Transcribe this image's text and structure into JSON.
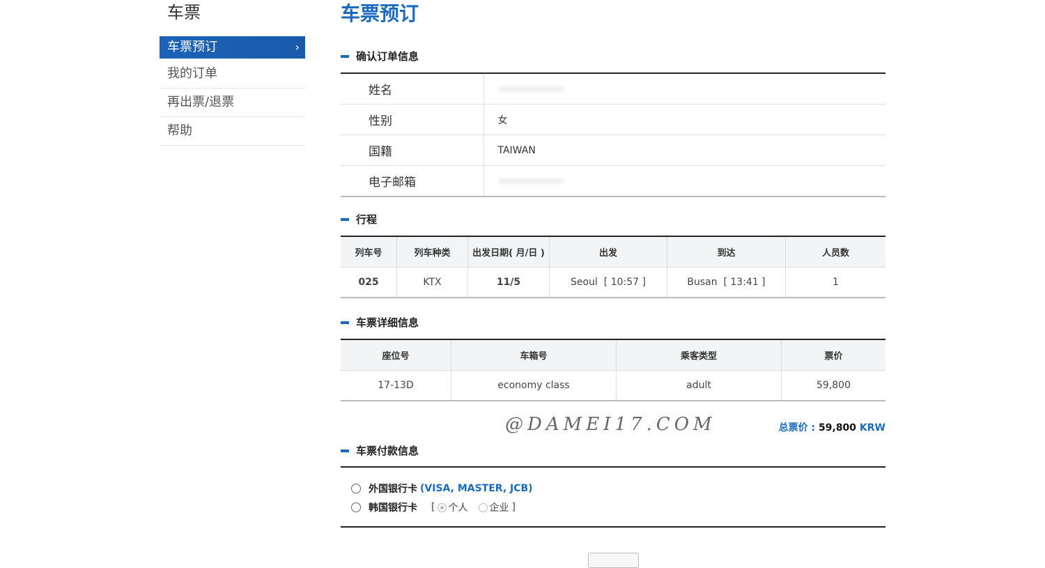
{
  "sidebar": {
    "title": "车票",
    "items": [
      {
        "label": "车票预订"
      },
      {
        "label": "我的订单"
      },
      {
        "label": "再出票/退票"
      },
      {
        "label": "帮助"
      }
    ]
  },
  "page_title": "车票预订",
  "order_info": {
    "heading": "确认订单信息",
    "rows": [
      {
        "label": "姓名",
        "value": ""
      },
      {
        "label": "性别",
        "value": "女"
      },
      {
        "label": "国籍",
        "value": "TAIWAN"
      },
      {
        "label": "电子邮箱",
        "value": ""
      }
    ]
  },
  "itinerary": {
    "heading": "行程",
    "headers": [
      "列车号",
      "列车种类",
      "出发日期( 月/日 )",
      "出发",
      "到达",
      "人员数"
    ],
    "row": [
      "025",
      "KTX",
      "11/5",
      "Seoul  [ 10:57 ]",
      "Busan  [ 13:41 ]",
      "1"
    ]
  },
  "ticket_detail": {
    "heading": "车票详细信息",
    "headers": [
      "座位号",
      "车箱号",
      "乘客类型",
      "票价"
    ],
    "row": [
      "17-13D",
      "economy class",
      "adult",
      "59,800"
    ]
  },
  "watermark": "@DAMEI17.COM",
  "total": {
    "label": "总票价 :",
    "amount": "59,800",
    "currency": "KRW"
  },
  "payment": {
    "heading": "车票付款信息",
    "foreign_card": "外国银行卡",
    "foreign_card_types": "(VISA, MASTER, JCB)",
    "korean_card": "韩国银行卡",
    "bracket_open": "[",
    "bracket_close": "]",
    "opt_personal": "个人",
    "opt_company": "企业"
  },
  "colors": {
    "accent": "#1a6bc0",
    "nav_active": "#1a5fb4"
  }
}
